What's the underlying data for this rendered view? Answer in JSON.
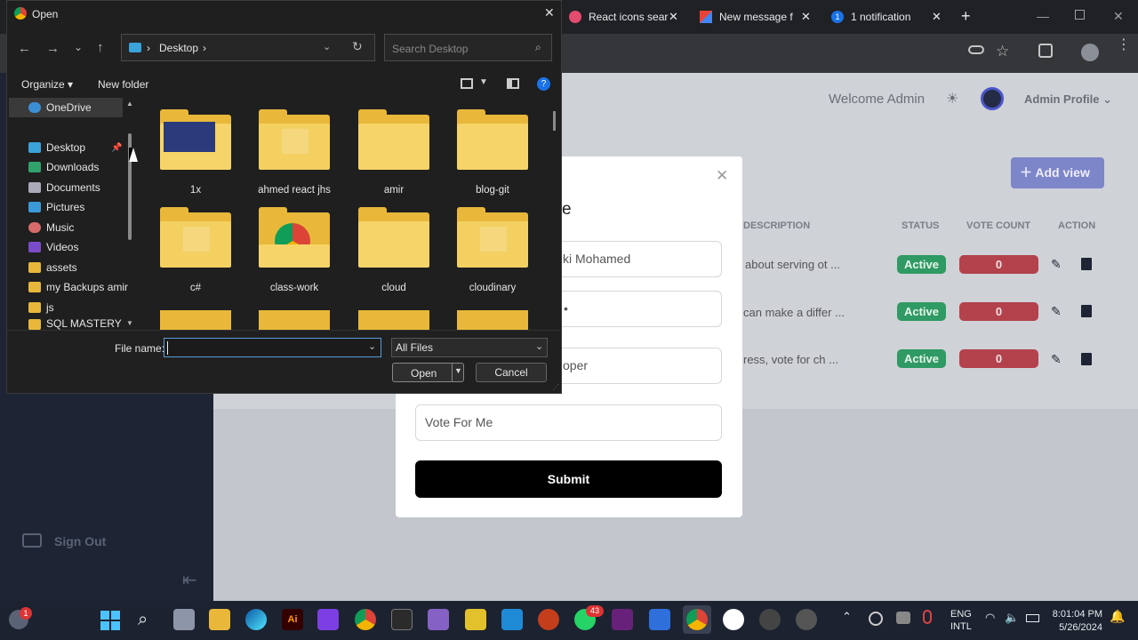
{
  "browser": {
    "tabs": [
      {
        "title": "React icons sear"
      },
      {
        "title": "New message fr"
      },
      {
        "title": "1 notification",
        "badge": "1"
      }
    ]
  },
  "app": {
    "welcome": "Welcome Admin",
    "profile": "Admin Profile",
    "add_view": "Add view",
    "sign_out": "Sign Out",
    "table": {
      "headers": [
        "DESCRIPTION",
        "STATUS",
        "VOTE COUNT",
        "ACTION"
      ],
      "rows": [
        {
          "description": "about serving ot ...",
          "status": "Active",
          "votes": "0"
        },
        {
          "description": "can make a differ ...",
          "status": "Active",
          "votes": "0"
        },
        {
          "description": "ress, vote for ch ...",
          "status": "Active",
          "votes": "0"
        }
      ]
    }
  },
  "modal": {
    "title_fragment": "e",
    "fields": [
      "ki Mohamed",
      "•",
      "oper",
      "Vote For Me"
    ],
    "submit": "Submit"
  },
  "dialog": {
    "title": "Open",
    "path": "Desktop",
    "search_placeholder": "Search Desktop",
    "organize": "Organize",
    "new_folder": "New folder",
    "nav": [
      "OneDrive",
      "Desktop",
      "Downloads",
      "Documents",
      "Pictures",
      "Music",
      "Videos",
      "assets",
      "my Backups amir",
      "js",
      "SQL MASTERY"
    ],
    "folders": [
      "1x",
      "ahmed react jhs",
      "amir",
      "blog-git",
      "c#",
      "class-work",
      "cloud",
      "cloudinary"
    ],
    "file_name_label": "File name:",
    "file_name_value": "",
    "file_type": "All Files",
    "open": "Open",
    "cancel": "Cancel"
  },
  "taskbar": {
    "lang": "ENG",
    "layout": "INTL",
    "time": "8:01:04 PM",
    "date": "5/26/2024",
    "whatsapp_badge": "43",
    "start_badge": "1"
  },
  "colors": {
    "accent": "#4a55c9",
    "active": "#2f9a63",
    "vote": "#b3424d"
  }
}
